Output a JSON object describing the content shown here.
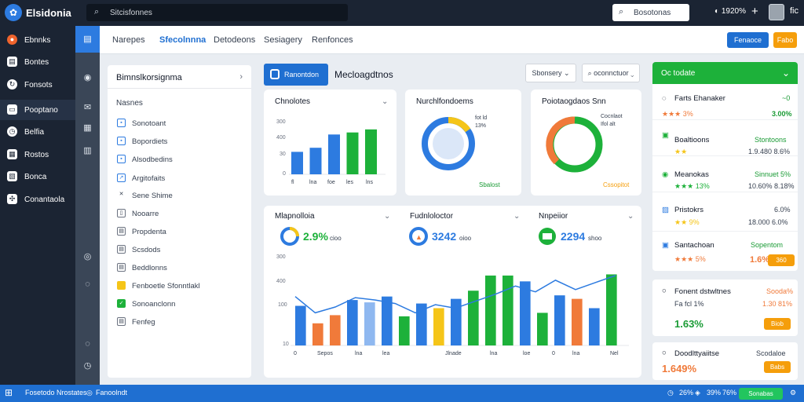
{
  "app": {
    "name": "Elsidonia",
    "search_placeholder": "Sitcisfonnes",
    "search2_placeholder": "Bosotonas",
    "status_text": "1920%",
    "more": "fic"
  },
  "icons": {
    "logo": "leaf-logo-icon",
    "search": "search-icon",
    "plus": "plus-icon",
    "avatar": "user-avatar",
    "chevron": "chevron-down-icon"
  },
  "sidebar": {
    "items": [
      {
        "label": "Ebnnks",
        "icon": "flame-icon"
      },
      {
        "label": "Bontes",
        "icon": "file-icon"
      },
      {
        "label": "Fonsots",
        "icon": "refresh-icon"
      },
      {
        "label": "Pooptano",
        "icon": "folder-icon"
      },
      {
        "label": "Belfia",
        "icon": "clock-icon"
      },
      {
        "label": "Rostos",
        "icon": "grid-icon"
      },
      {
        "label": "Bonca",
        "icon": "layout-icon"
      },
      {
        "label": "Conantaola",
        "icon": "apps-icon"
      }
    ],
    "active": 3
  },
  "rail": [
    "grid-icon",
    "eye-icon",
    "mail-icon",
    "calendar-icon",
    "book-icon",
    "settings-icon",
    "help-icon",
    "info-icon",
    "clock-icon"
  ],
  "tabs": [
    "Narepes",
    "Sfecolnnna",
    "Detodeons",
    "Sesiagery",
    "Renfonces"
  ],
  "tabs_active": 1,
  "actions": {
    "primary": "Fenaoce",
    "secondary": "Fabo"
  },
  "left_panel": {
    "title": "Bimnslkorsignma",
    "subtitle": "Nasnes",
    "items": [
      "Sonotoant",
      "Bopordiets",
      "Alsodbedins",
      "Argitofaits",
      "Sene Shime",
      "Nooarre",
      "Propdenta",
      "Scsdods",
      "Beddlonns",
      "Fenboetle Sfonntlakl",
      "Sonoanclonn",
      "Fenfeg"
    ]
  },
  "toolbar": {
    "chip": "Ranontdon",
    "section_title": "Mecloagdtnos",
    "select1": "Sbonsery",
    "select2": "oconnctuor"
  },
  "cards_top": [
    {
      "title": "Chnolotes",
      "yticks": [
        "300",
        "400",
        "30",
        "0"
      ],
      "xlabels": [
        "fl",
        "lna",
        "foe",
        "les",
        "lns"
      ]
    },
    {
      "title": "Nurchlfondoems",
      "legend": [
        "fot ld",
        "13%"
      ],
      "footer": "Sbalost"
    },
    {
      "title": "Poiotaogdaos Snn",
      "legend": [
        "Cocnlaot",
        "Ifol alt"
      ],
      "footer": "Cssopitot"
    }
  ],
  "cards_mid": [
    {
      "title": "Mlapnolloia",
      "kpi": "2.9%",
      "kpi_sub": "cioo"
    },
    {
      "title": "Fudnloloctor",
      "kpi": "3242",
      "kpi_sub": "oioo"
    },
    {
      "title": "Nnpeiior",
      "kpi": "2294",
      "kpi_sub": "shoo"
    }
  ],
  "big_chart": {
    "yticks": [
      "300",
      "400",
      "100",
      "10"
    ],
    "xlabels": [
      "0",
      "Sepos",
      "lna",
      "lea",
      "Jlnade",
      "lna",
      "loe",
      "0",
      "lna",
      "Nel"
    ]
  },
  "right_panel": {
    "header": "Oc todate",
    "rows": [
      {
        "title": "Farts Ehanaker",
        "rating": "★★★ 3%",
        "value": "",
        "value2": "3.00%",
        "side": "~0"
      },
      {
        "title": "Boaltioons",
        "rating": "★★",
        "value": "Stontoons",
        "value2": "1.9.480  8.6%"
      },
      {
        "title": "Meanokas",
        "rating": "★★★ 13%",
        "value": "Sinnuet 5%",
        "value2": "10.60%  8.18%"
      },
      {
        "title": "Pristokrs",
        "rating": "★★ 9%",
        "value": "6.0%",
        "value2": "18.000  6.0%"
      },
      {
        "title": "Santachoan",
        "rating": "★★★ 5%",
        "value": "Sopentom",
        "value2": "1.6%",
        "badge": "360"
      }
    ],
    "card2": {
      "title": "Fonent dstwltnes",
      "sub": "Fa fcl 1%",
      "value": "1.63%",
      "side": "Sooda%",
      "side2": "1.30 81%",
      "badge": "Biob"
    },
    "card3": {
      "title": "Doodlttyaiitse",
      "value": "1.649%",
      "side": "Scodaloe",
      "badge": "Babs"
    }
  },
  "statusbar": {
    "left": "Fosetodo Nrostates",
    "left2": "Fanoolndt",
    "r1": "26%",
    "r2": "39%",
    "r3": "76%",
    "btn": "Sonabas"
  },
  "colors": {
    "blue": "#2d7be0",
    "green": "#1db13a",
    "orange": "#f59e0b",
    "navy": "#1b2433"
  },
  "chart_data": [
    {
      "type": "bar",
      "title": "Chnolotes",
      "categories": [
        "fl",
        "lna",
        "foe",
        "les",
        "lns"
      ],
      "series": [
        {
          "values": [
            110,
            130,
            195,
            205,
            220
          ]
        }
      ],
      "colors": [
        "#2d7be0",
        "#2d7be0",
        "#2d7be0",
        "#1db13a",
        "#1db13a"
      ],
      "ylim": [
        0,
        300
      ]
    },
    {
      "type": "pie",
      "title": "Nurchlfondoems",
      "values": [
        13,
        87
      ],
      "colors": [
        "#f5c518",
        "#2d7be0"
      ]
    },
    {
      "type": "pie",
      "title": "Poiotaogdaos Snn",
      "values": [
        25,
        35,
        40
      ],
      "colors": [
        "#f07a3a",
        "#1db13a",
        "#1db13a"
      ]
    },
    {
      "type": "bar",
      "title": "Dashboard combined",
      "series": [
        {
          "values": [
            170,
            95,
            130,
            195,
            185,
            210,
            125,
            180,
            160,
            200,
            235,
            300,
            300,
            275,
            140,
            215,
            200,
            160,
            305
          ]
        }
      ],
      "colors": [
        "#2d7be0",
        "#f07a3a",
        "#f07a3a",
        "#2d7be0",
        "#8fb8f0",
        "#2d7be0",
        "#1db13a",
        "#2d7be0",
        "#f5c518",
        "#2d7be0",
        "#1db13a",
        "#1db13a",
        "#1db13a",
        "#2d7be0",
        "#1db13a",
        "#2d7be0",
        "#f07a3a",
        "#2d7be0",
        "#1db13a"
      ],
      "ylim": [
        0,
        320
      ],
      "line": [
        210,
        140,
        165,
        205,
        195,
        180,
        140,
        175,
        160,
        190,
        220,
        255,
        230,
        280,
        240,
        270,
        300
      ]
    }
  ]
}
